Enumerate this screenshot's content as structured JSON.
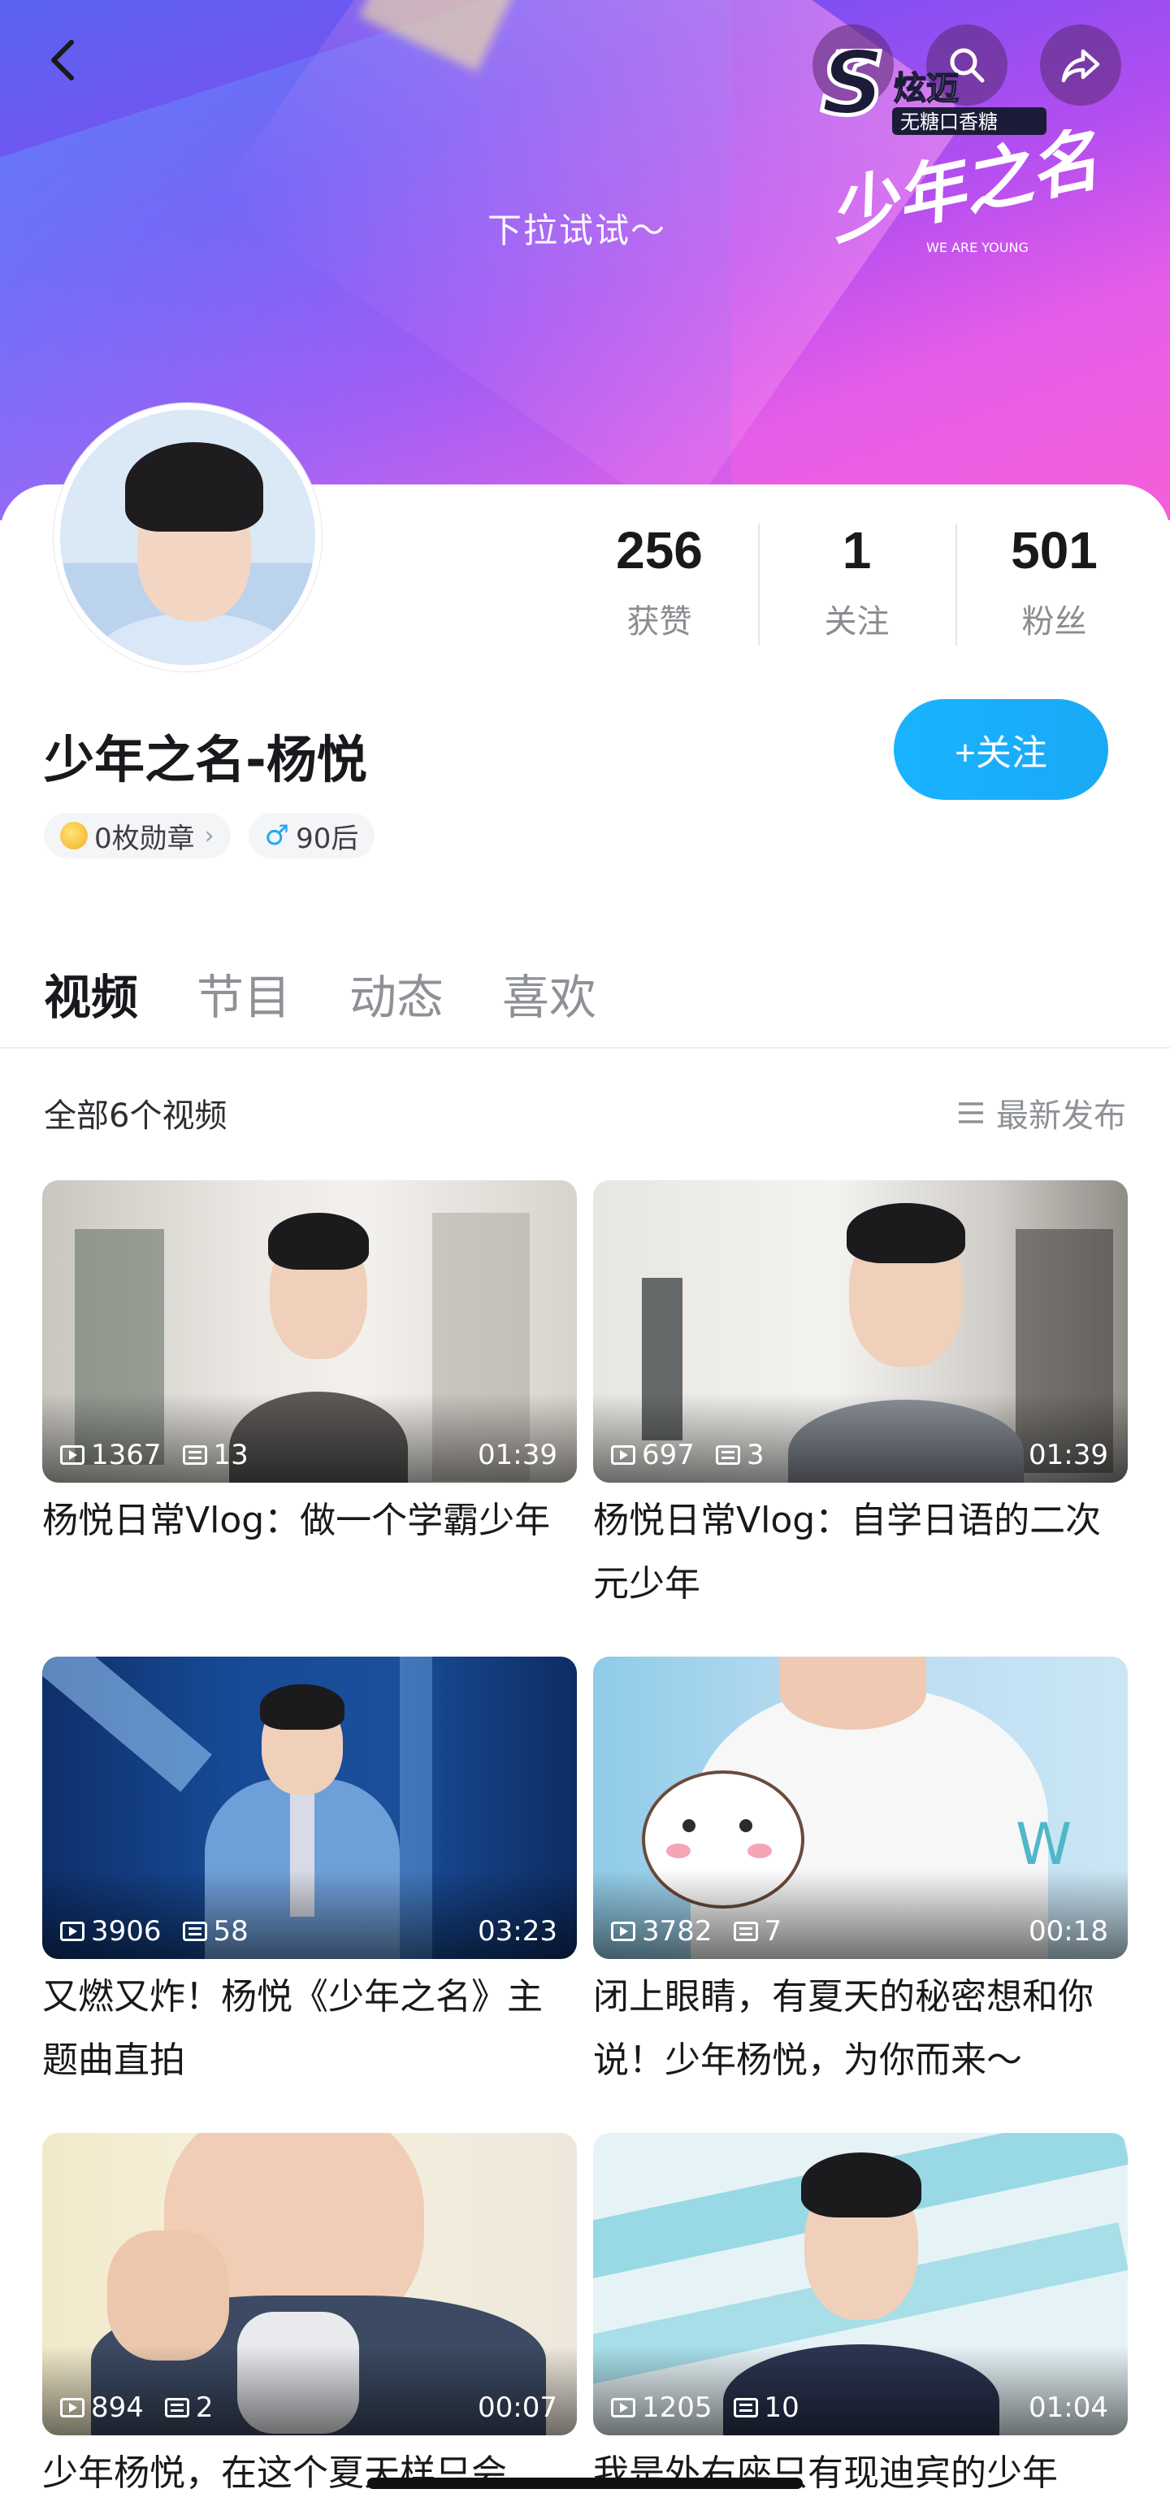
{
  "header": {
    "pull_hint": "下拉试试～",
    "icons": [
      "back-arrow-icon",
      "cast-icon",
      "search-icon",
      "share-icon"
    ],
    "logo_text": {
      "brand": "炫迈",
      "brand_sub": "无糖口香糖",
      "show": "少年之名",
      "show_en": "WE ARE YOUNG"
    }
  },
  "profile": {
    "name": "少年之名-杨悦",
    "follow_button": "+关注",
    "stats": [
      {
        "value": "256",
        "label": "获赞"
      },
      {
        "value": "1",
        "label": "关注"
      },
      {
        "value": "501",
        "label": "粉丝"
      }
    ],
    "tags": {
      "medals": "0枚勋章",
      "age": "90后"
    }
  },
  "tabs": [
    "视频",
    "节目",
    "动态",
    "喜欢"
  ],
  "list": {
    "count_label": "全部6个视频",
    "sort_label": "最新发布"
  },
  "videos": [
    {
      "views": "1367",
      "danmaku": "13",
      "duration": "01:39",
      "title": "杨悦日常Vlog：做一个学霸少年"
    },
    {
      "views": "697",
      "danmaku": "3",
      "duration": "01:39",
      "title": "杨悦日常Vlog：自学日语的二次元少年"
    },
    {
      "views": "3906",
      "danmaku": "58",
      "duration": "03:23",
      "title": "又燃又炸！杨悦《少年之名》主题曲直拍"
    },
    {
      "views": "3782",
      "danmaku": "7",
      "duration": "00:18",
      "title": "闭上眼睛，有夏天的秘密想和你说！少年杨悦，为你而来～"
    },
    {
      "views": "894",
      "danmaku": "2",
      "duration": "00:07",
      "title": "少年杨悦，在这个夏天样只会"
    },
    {
      "views": "1205",
      "danmaku": "10",
      "duration": "01:04",
      "title": "我是外右座只有现迪宾的少年"
    }
  ],
  "colors": {
    "accent_blue": "#19b3ff",
    "text_primary": "#18191c",
    "text_secondary": "#8e9196"
  }
}
